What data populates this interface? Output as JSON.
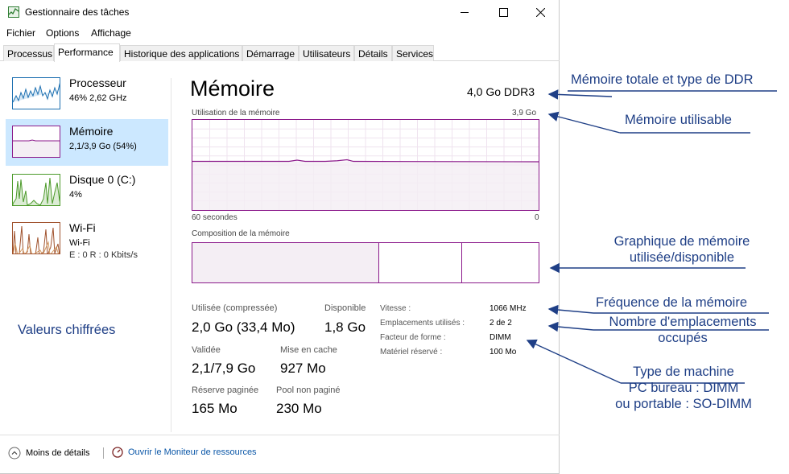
{
  "window": {
    "title": "Gestionnaire des tâches",
    "min_glyph": "—",
    "max_glyph": "☐",
    "close_glyph": "✕"
  },
  "menu": [
    "Fichier",
    "Options",
    "Affichage"
  ],
  "tabs": [
    "Processus",
    "Performance",
    "Historique des applications",
    "Démarrage",
    "Utilisateurs",
    "Détails",
    "Services"
  ],
  "active_tab": "Performance",
  "sidebar": [
    {
      "title": "Processeur",
      "sub": "46% 2,62 GHz",
      "sub2": "",
      "color": "#1c6fb0"
    },
    {
      "title": "Mémoire",
      "sub": "2,1/3,9 Go (54%)",
      "sub2": "",
      "color": "#8b1a8b"
    },
    {
      "title": "Disque 0 (C:)",
      "sub": "4%",
      "sub2": "",
      "color": "#4c9a2a"
    },
    {
      "title": "Wi-Fi",
      "sub": "Wi-Fi",
      "sub2": "E : 0 R : 0 Kbits/s",
      "color": "#a0522d"
    }
  ],
  "main": {
    "title": "Mémoire",
    "total": "4,0 Go DDR3",
    "usage_label": "Utilisation de la mémoire",
    "usage_max": "3,9 Go",
    "x_left": "60 secondes",
    "x_right": "0",
    "composition_label": "Composition de la mémoire",
    "usage_level": 0.54,
    "composition_used_fraction": 0.54,
    "composition_cached_fraction": 0.24,
    "accent": "#8b1a8b",
    "fill": "#f4eef4"
  },
  "stats": {
    "used_label": "Utilisée (compressée)",
    "used_value": "2,0 Go (33,4 Mo)",
    "available_label": "Disponible",
    "available_value": "1,8 Go",
    "committed_label": "Validée",
    "committed_value": "2,1/7,9 Go",
    "cached_label": "Mise en cache",
    "cached_value": "927 Mo",
    "paged_label": "Réserve paginée",
    "paged_value": "165 Mo",
    "nonpaged_label": "Pool non paginé",
    "nonpaged_value": "230 Mo"
  },
  "details": [
    {
      "key": "Vitesse :",
      "value": "1066 MHz"
    },
    {
      "key": "Emplacements utilisés :",
      "value": "2 de 2"
    },
    {
      "key": "Facteur de forme :",
      "value": "DIMM"
    },
    {
      "key": "Matériel réservé :",
      "value": "100 Mo"
    }
  ],
  "footer": {
    "less_details": "Moins de détails",
    "resmon": "Ouvrir le Moniteur de ressources"
  },
  "annotations": {
    "total_type": "Mémoire totale et type de DDR",
    "usable": "Mémoire utilisable",
    "graph_line1": "Graphique de mémoire",
    "graph_line2": "utilisée/disponible",
    "frequency": "Fréquence de la mémoire",
    "slots_line1": "Nombre d'emplacements",
    "slots_line2": "occupés",
    "machine_line1": "Type de machine",
    "machine_line2": "PC bureau : DIMM",
    "machine_line3": "ou portable : SO-DIMM",
    "values": "Valeurs chiffrées",
    "color": "#1f3f86"
  }
}
